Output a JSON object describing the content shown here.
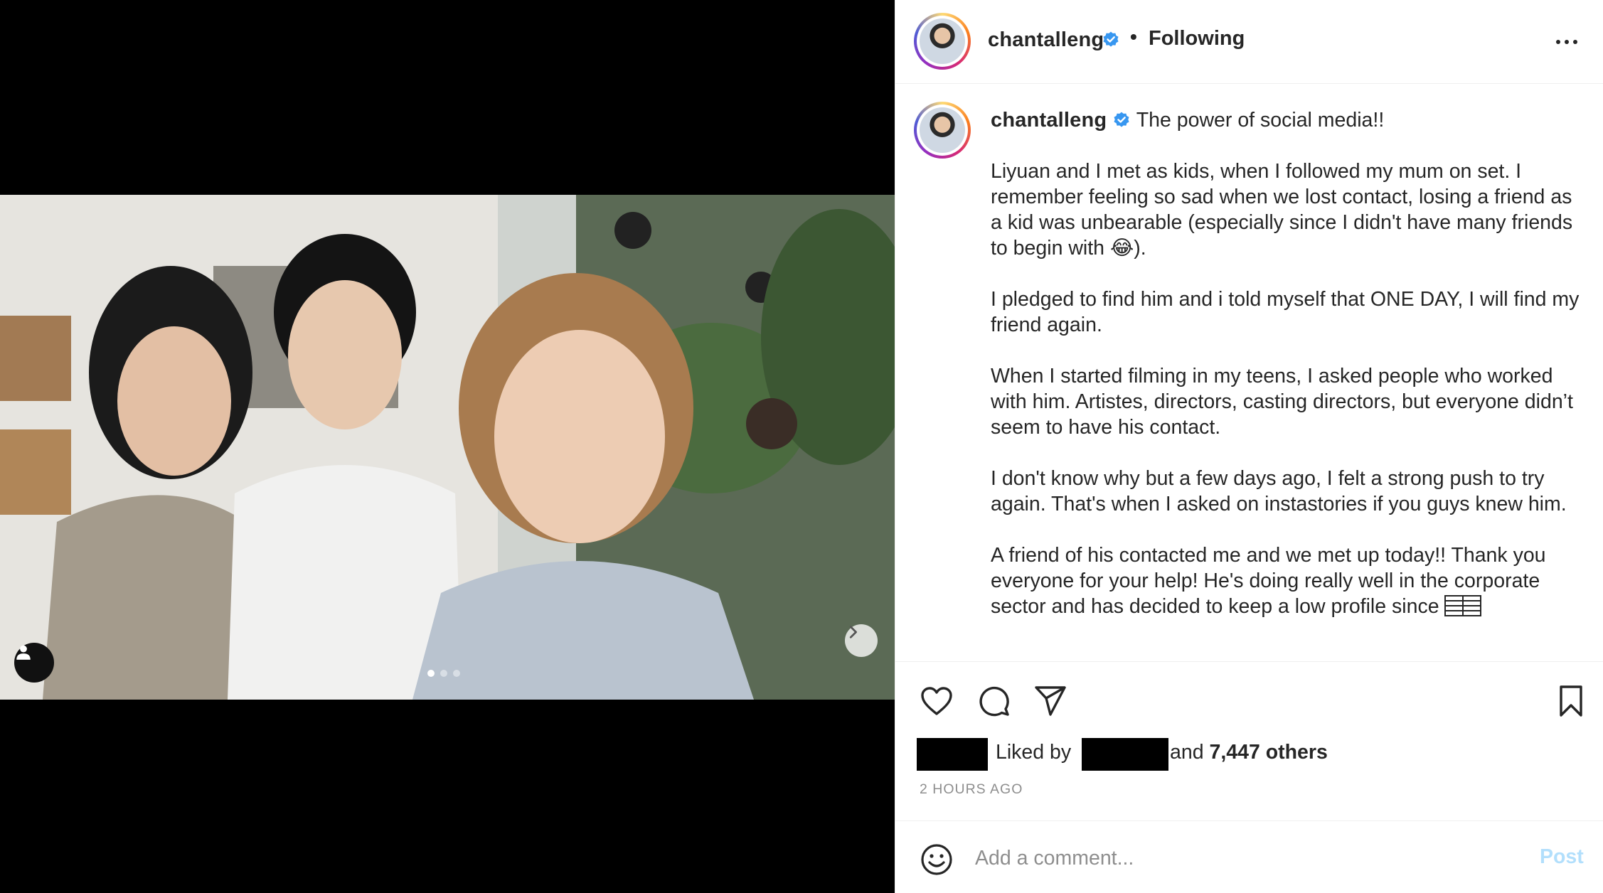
{
  "post": {
    "username": "chantalleng",
    "separator": "•",
    "follow_status": "Following",
    "image_alt": "Selfie of three friends in a café",
    "carousel": {
      "slides": 3,
      "active": 1
    }
  },
  "caption": {
    "username": "chantalleng",
    "first_line": "The power of social media!!",
    "paragraphs": [
      "Liyuan and I met as kids, when I followed my mum on set. I remember feeling so sad when we lost contact, losing a friend as a kid was unbearable (especially since I didn't have many friends to begin with 😂).",
      "I pledged to find him and i told myself that ONE DAY, I will find my friend again.",
      "When I started filming in my teens, I asked people who worked with him. Artistes, directors, casting directors, but everyone didn’t seem to have his contact.",
      "I don't know why but a few days ago, I felt a strong push to try again. That's when I asked on instastories if you guys knew him.",
      "A friend of his contacted me and we met up today!! Thank you everyone for your help! He's doing really well in the corporate sector and has decided to keep a low profile since"
    ]
  },
  "likes": {
    "liked_by_label": "Liked by",
    "and_label": "and",
    "count_label": "7,447 others"
  },
  "timestamp": "2 HOURS AGO",
  "comment": {
    "placeholder": "Add a comment...",
    "post_label": "Post"
  },
  "icons": {
    "verified": "verified-badge-icon",
    "more": "more-options-icon",
    "like": "heart-icon",
    "comment": "comment-bubble-icon",
    "share": "paper-plane-icon",
    "save": "bookmark-icon",
    "emoji": "smiley-icon",
    "next": "chevron-right-icon",
    "tag": "user-tag-icon"
  },
  "colors": {
    "verified_blue": "#3897f0",
    "post_button_disabled": "#b2dffc",
    "muted_text": "#8e8e8e"
  }
}
